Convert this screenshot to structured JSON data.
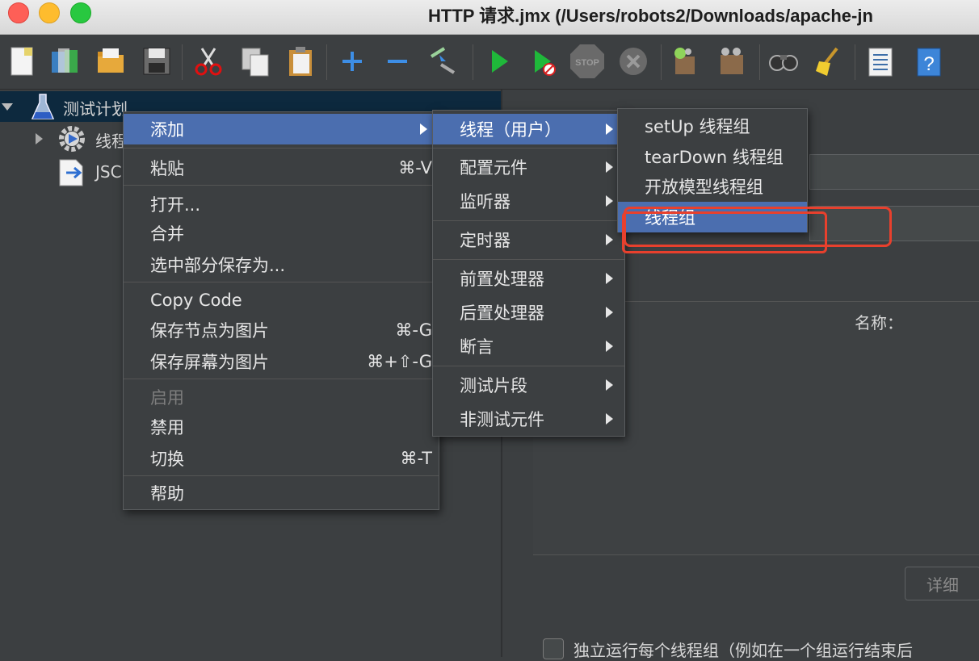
{
  "window": {
    "title": "HTTP 请求.jmx (/Users/robots2/Downloads/apache-jn"
  },
  "tree": {
    "items": [
      {
        "label": "测试计划"
      },
      {
        "label": "线程"
      },
      {
        "label": "JSC"
      }
    ]
  },
  "context_menu": {
    "items": [
      {
        "label": "添加",
        "shortcut": ""
      },
      {
        "label": "粘贴",
        "shortcut": "⌘-V"
      },
      {
        "label": "打开...",
        "shortcut": ""
      },
      {
        "label": "合并",
        "shortcut": ""
      },
      {
        "label": "选中部分保存为...",
        "shortcut": ""
      },
      {
        "label": "Copy Code",
        "shortcut": ""
      },
      {
        "label": "保存节点为图片",
        "shortcut": "⌘-G"
      },
      {
        "label": "保存屏幕为图片",
        "shortcut": "⌘+⇧-G"
      },
      {
        "label": "启用",
        "shortcut": ""
      },
      {
        "label": "禁用",
        "shortcut": ""
      },
      {
        "label": "切换",
        "shortcut": "⌘-T"
      },
      {
        "label": "帮助",
        "shortcut": ""
      }
    ]
  },
  "add_submenu": {
    "items": [
      {
        "label": "线程（用户）"
      },
      {
        "label": "配置元件"
      },
      {
        "label": "监听器"
      },
      {
        "label": "定时器"
      },
      {
        "label": "前置处理器"
      },
      {
        "label": "后置处理器"
      },
      {
        "label": "断言"
      },
      {
        "label": "测试片段"
      },
      {
        "label": "非测试元件"
      }
    ]
  },
  "threads_submenu": {
    "items": [
      {
        "label": "setUp 线程组"
      },
      {
        "label": "tearDown 线程组"
      },
      {
        "label": "开放模型线程组"
      },
      {
        "label": "线程组"
      }
    ]
  },
  "right_panel": {
    "name_label": "名称：",
    "detail_button": "详细",
    "checkbox_label": "独立运行每个线程组（例如在一个组运行结束后"
  },
  "colors": {
    "highlight": "#4b6eaf",
    "annotation": "#e8402d"
  }
}
